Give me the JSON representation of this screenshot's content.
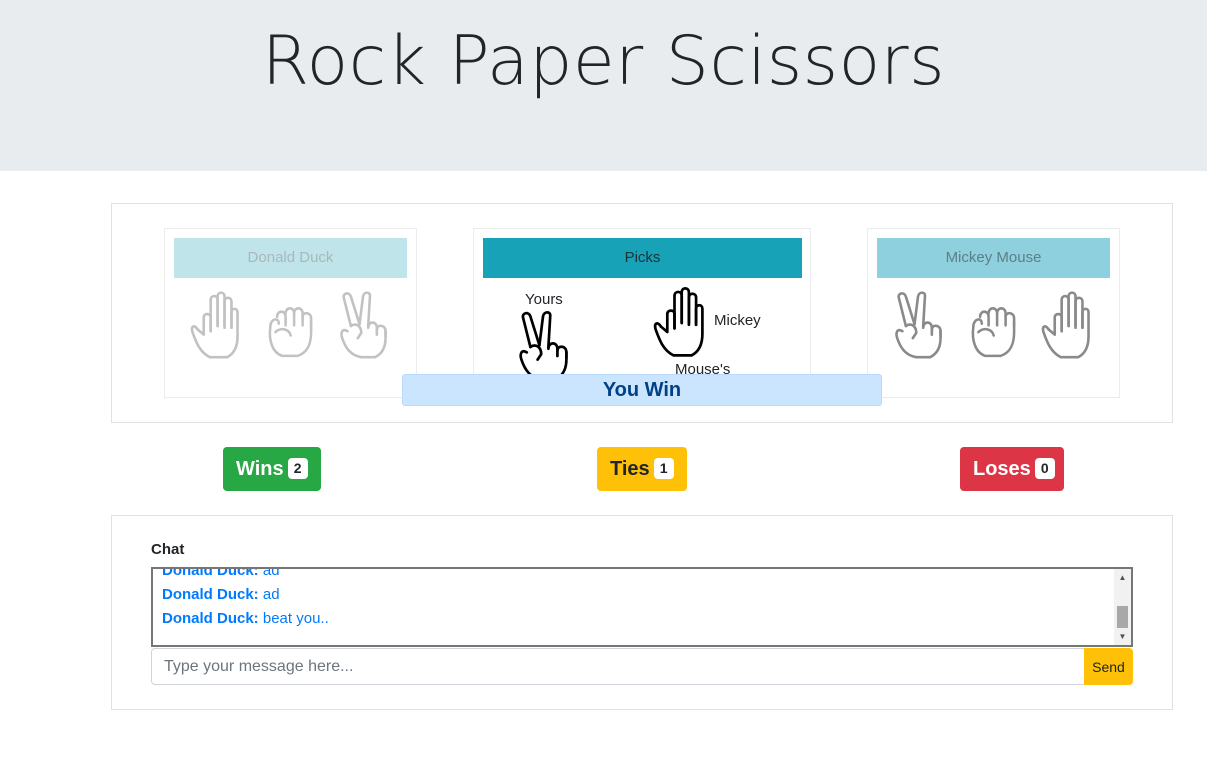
{
  "header": {
    "title": "Rock Paper Scissors"
  },
  "player1": {
    "name": "Donald Duck",
    "choices": [
      "paper-icon",
      "rock-icon",
      "scissors-icon"
    ]
  },
  "player2": {
    "name": "Mickey Mouse",
    "choices": [
      "scissors-icon",
      "rock-icon",
      "paper-icon"
    ]
  },
  "picks": {
    "title": "Picks",
    "yours_label": "Yours",
    "yours_pick": "scissors-icon",
    "opponent_label_1": "Mickey",
    "opponent_label_2": "Mouse's",
    "opponent_pick": "paper-icon"
  },
  "result": "You Win",
  "scores": {
    "wins_label": "Wins",
    "wins": "2",
    "ties_label": "Ties",
    "ties": "1",
    "loses_label": "Loses",
    "loses": "0"
  },
  "chat": {
    "title": "Chat",
    "messages": [
      {
        "author": "Donald Duck:",
        "text": "ad"
      },
      {
        "author": "Donald Duck:",
        "text": "ad"
      },
      {
        "author": "Donald Duck:",
        "text": "beat you.."
      }
    ],
    "placeholder": "Type your message here...",
    "send_label": "Send"
  },
  "colors": {
    "wins": "#28a745",
    "ties": "#ffc107",
    "loses": "#dc3545",
    "picks_header": "#17a2b8",
    "result_bg": "#cce5ff"
  }
}
